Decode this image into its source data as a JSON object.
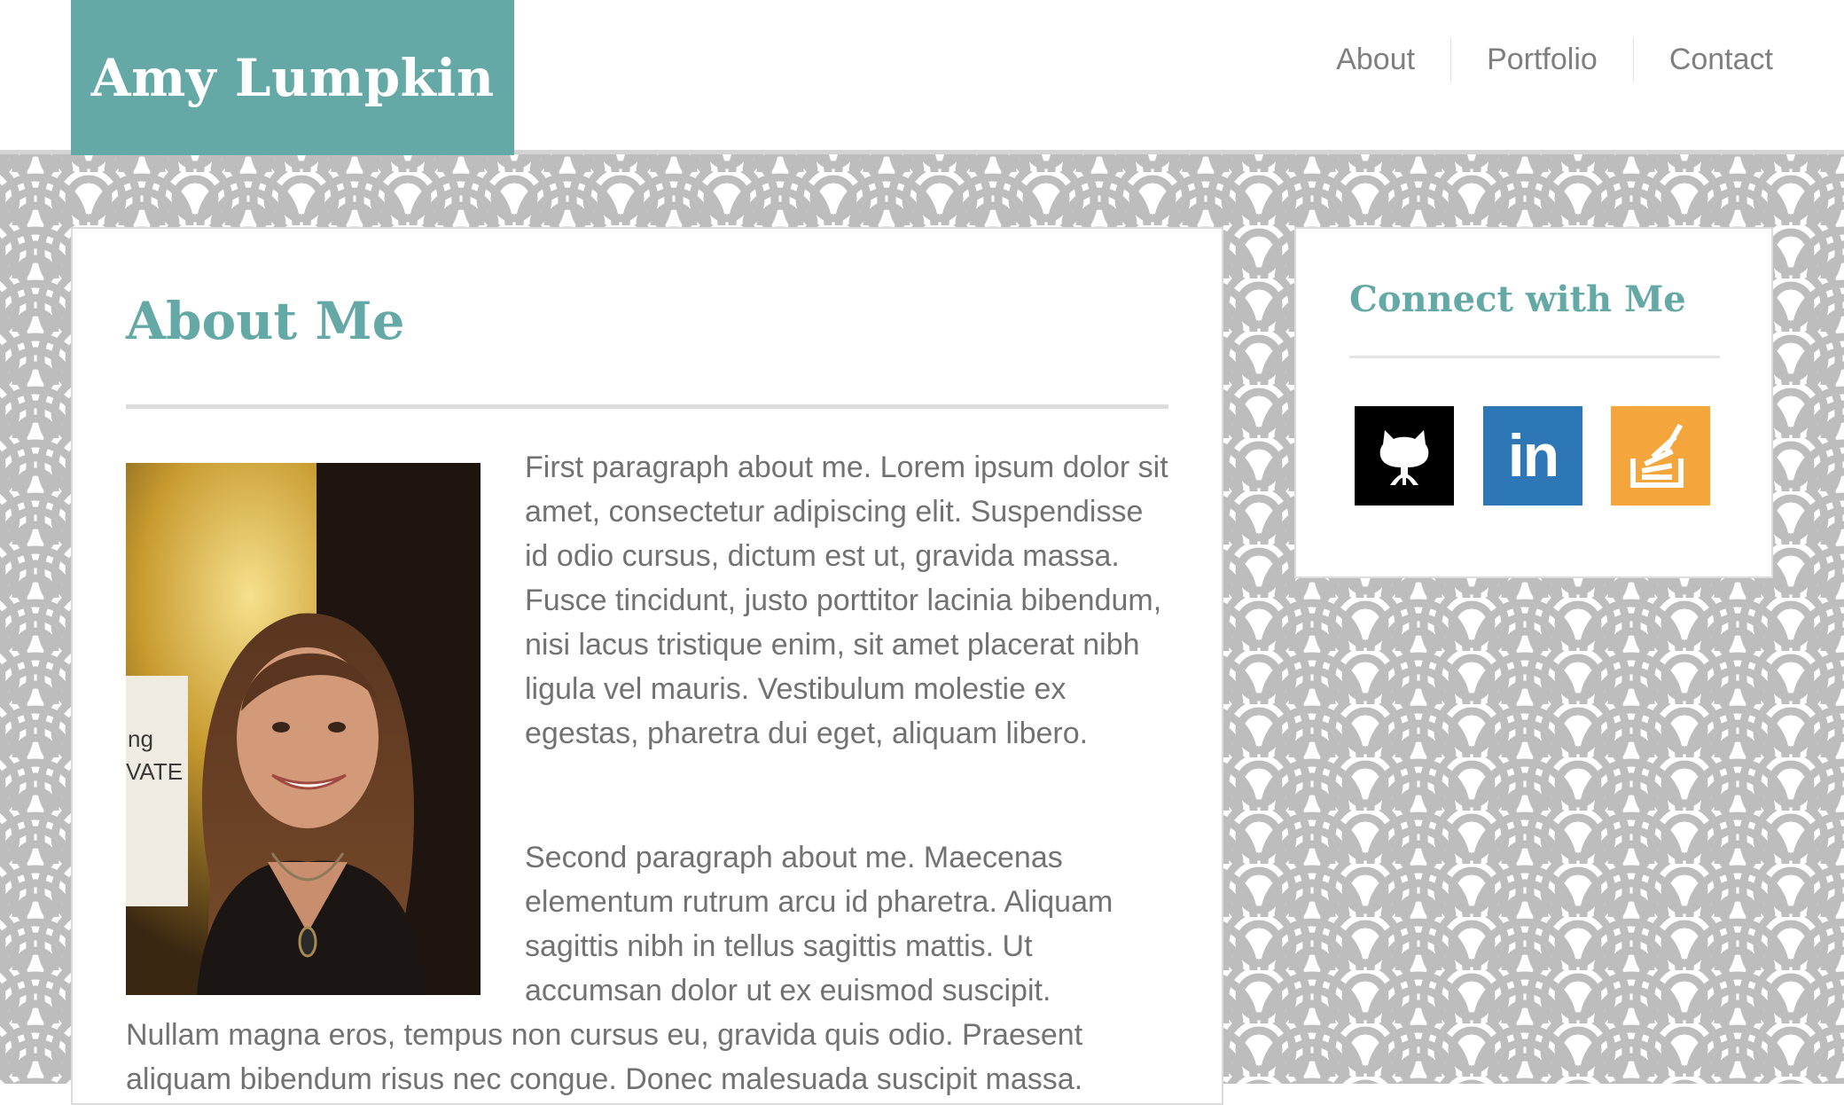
{
  "site": {
    "name": "Amy Lumpkin"
  },
  "nav": {
    "items": [
      {
        "label": "About"
      },
      {
        "label": "Portfolio"
      },
      {
        "label": "Contact"
      }
    ]
  },
  "about": {
    "title": "About Me",
    "photo_icon": "profile-photo",
    "paragraph_1": "First paragraph about me. Lorem ipsum dolor sit amet, consectetur adipiscing elit. Suspendisse id odio cursus, dictum est ut, gravida massa. Fusce tincidunt, justo porttitor lacinia bibendum, nisi lacus tristique enim, sit amet placerat nibh ligula vel mauris. Vestibulum molestie ex egestas, pharetra dui eget, aliquam libero.",
    "paragraph_2_wrapped": "Second paragraph about me. Maecenas elementum rutrum arcu id pharetra. Aliquam sagittis nibh in tellus sagittis mattis. Ut accumsan dolor ut ex euismod suscipit.",
    "paragraph_2_full_width": "Nullam magna eros, tempus non cursus eu, gravida quis odio. Praesent aliquam bibendum risus nec congue. Donec malesuada suscipit massa."
  },
  "connect": {
    "title": "Connect with Me",
    "links": [
      {
        "icon": "github-icon",
        "color": "#000000"
      },
      {
        "icon": "linkedin-icon",
        "label": "in",
        "color": "#2d77b7"
      },
      {
        "icon": "stackoverflow-icon",
        "color": "#f4a53c"
      }
    ]
  },
  "colors": {
    "accent": "#64a9a5",
    "nav_text": "#7f7f7f",
    "body_text": "#727272",
    "pattern_fill": "#bdbdbd",
    "pattern_bg": "#ffffff"
  }
}
